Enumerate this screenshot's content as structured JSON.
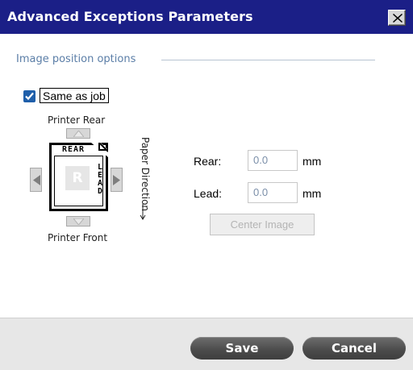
{
  "window": {
    "title": "Advanced Exceptions Parameters",
    "close_icon": "close-icon"
  },
  "section": {
    "label": "Image position options"
  },
  "same_as_job": {
    "label": "Same as job",
    "checked": true
  },
  "diagram": {
    "printer_rear": "Printer Rear",
    "printer_front": "Printer Front",
    "paper_direction": "Paper Direction",
    "rear_text": "REAR",
    "lead_text": "LEAD",
    "page_letter": "R"
  },
  "fields": {
    "rear_label": "Rear:",
    "rear_value": "0.0",
    "rear_unit": "mm",
    "lead_label": "Lead:",
    "lead_value": "0.0",
    "lead_unit": "mm"
  },
  "buttons": {
    "center_image": "Center Image",
    "save": "Save",
    "cancel": "Cancel"
  },
  "colors": {
    "titlebar": "#1b1f87",
    "accent": "#1f5faa",
    "section_text": "#5b7ea7"
  }
}
